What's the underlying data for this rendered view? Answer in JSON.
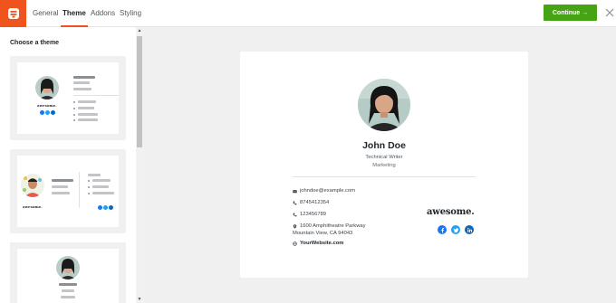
{
  "header": {
    "tabs": [
      {
        "label": "General"
      },
      {
        "label": "Theme"
      },
      {
        "label": "Addons"
      },
      {
        "label": "Styling"
      }
    ],
    "active_tab": "Theme",
    "continue_label": "Continue →"
  },
  "sidebar": {
    "title": "Choose a theme",
    "thumbnail_wordmark": "awesome."
  },
  "signature": {
    "name": "John Doe",
    "job_title": "Technical Writer",
    "department": "Marketing",
    "email": "johndoe@example.com",
    "phone": "8745412354",
    "mobile": "123456789",
    "address_line1": "1600 Amphitheatre Parkway",
    "address_line2": "Mountain View, CA 94043",
    "website": "YourWebsite.com",
    "wordmark": "awesome.",
    "socials": [
      {
        "icon": "facebook-icon",
        "color": "#1877f2"
      },
      {
        "icon": "twitter-icon",
        "color": "#1da1f2"
      },
      {
        "icon": "linkedin-icon",
        "color": "#0a66c2"
      }
    ]
  },
  "colors": {
    "brand_orange": "#f0541e",
    "continue_green": "#46a313",
    "preview_background": "#f0f0f1"
  }
}
